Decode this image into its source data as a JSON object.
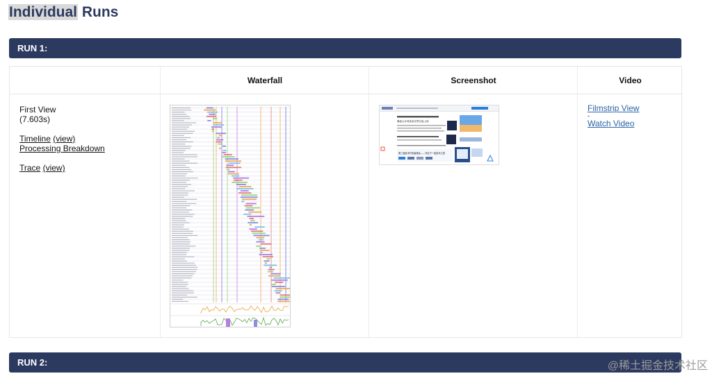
{
  "page": {
    "title_highlight": "Individual",
    "title_rest": " Runs"
  },
  "runs": [
    {
      "label": "RUN 1:"
    },
    {
      "label": "RUN 2:"
    }
  ],
  "table": {
    "headers": [
      "",
      "Waterfall",
      "Screenshot",
      "Video"
    ],
    "first_view": {
      "label": "First View",
      "time": "(7.603s)",
      "timeline_label": "Timeline",
      "timeline_view": "(view)",
      "processing_breakdown": "Processing Breakdown",
      "trace_label": "Trace",
      "trace_view": "(view)"
    },
    "video": {
      "filmstrip": "Filmstrip View",
      "separator": "-",
      "watch": "Watch Video"
    }
  },
  "screenshot_thumb": {
    "headline": "微信公众号技术文章已经上线",
    "ad_text": "第三届技术开发者峰会——开启下一段技术之旅"
  },
  "watermark": "@稀土掘金技术社区",
  "colors": {
    "run_bar": "#2c3a60",
    "title": "#2d3a5e",
    "link": "#2a63a6"
  }
}
